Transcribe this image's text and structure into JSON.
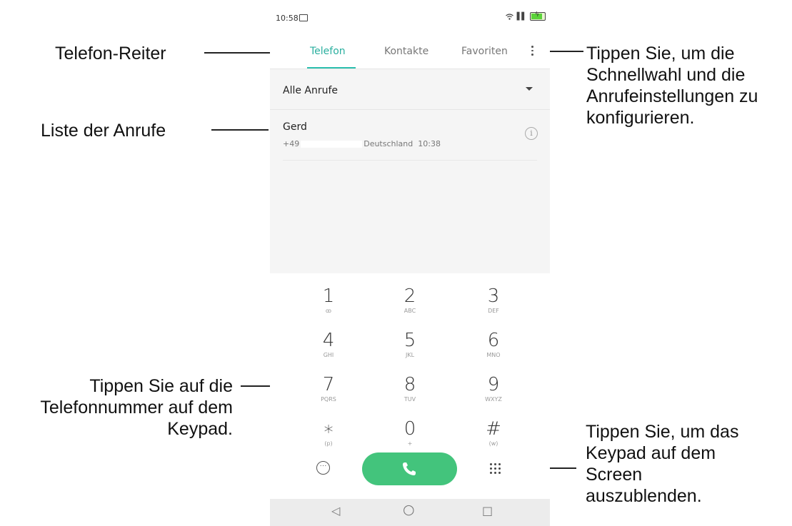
{
  "status_bar": {
    "time": "10:58"
  },
  "tabs": [
    {
      "label": "Telefon",
      "active": true
    },
    {
      "label": "Kontakte",
      "active": false
    },
    {
      "label": "Favoriten",
      "active": false
    }
  ],
  "filter": {
    "selected": "Alle Anrufe"
  },
  "calls": [
    {
      "name": "Gerd",
      "number_prefix": "+49",
      "location": "Deutschland",
      "time": "10:38"
    }
  ],
  "keypad": [
    {
      "digit": "1",
      "letters": "ꝏ"
    },
    {
      "digit": "2",
      "letters": "ABC"
    },
    {
      "digit": "3",
      "letters": "DEF"
    },
    {
      "digit": "4",
      "letters": "GHI"
    },
    {
      "digit": "5",
      "letters": "JKL"
    },
    {
      "digit": "6",
      "letters": "MNO"
    },
    {
      "digit": "7",
      "letters": "PQRS"
    },
    {
      "digit": "8",
      "letters": "TUV"
    },
    {
      "digit": "9",
      "letters": "WXYZ"
    },
    {
      "digit": "∗",
      "letters": "(p)"
    },
    {
      "digit": "0",
      "letters": "+"
    },
    {
      "digit": "#",
      "letters": "(w)"
    }
  ],
  "nav": {
    "back": "◁",
    "home": "○",
    "recents": "□"
  },
  "callouts": {
    "telefon_tab": "Telefon-Reiter",
    "call_list": "Liste der Anrufe",
    "keypad_tap": "Tippen Sie auf die Telefonnummer auf dem Keypad.",
    "more_menu": "Tippen Sie, um die Schnellwahl und die Anrufeinstellungen zu konfigurieren.",
    "hide_keypad": "Tippen Sie, um das Keypad auf dem Screen auszublenden."
  },
  "colors": {
    "accent": "#2aaf9f",
    "call_button": "#43c47c",
    "battery": "#5bd33a"
  }
}
